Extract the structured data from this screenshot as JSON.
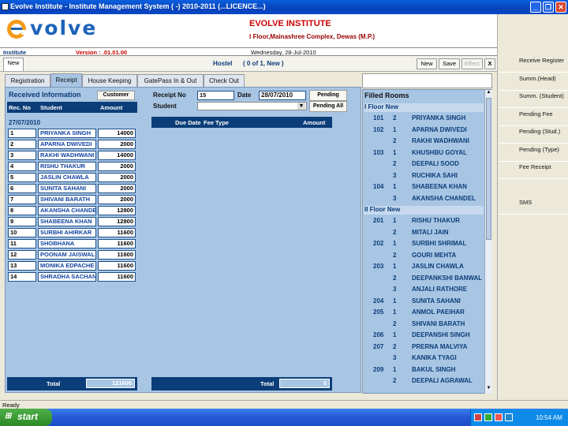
{
  "window": {
    "title": "Evolve Institute - Institute Management System ( -) 2010-2011 (...LICENCE...)"
  },
  "header": {
    "logo_text": "volve",
    "institute_name": "EVOLVE INSTITUTE",
    "address": "I Floor,Mainashree Complex, Dewas (M.P.)"
  },
  "infobar": {
    "institute": "Institute",
    "version": "Version : .01.01.00",
    "date": "Wednesday, 28-Jul-2010"
  },
  "hostelbar": {
    "tab_new": "New",
    "title": "Hostel",
    "record": "( 0 of 1, New )",
    "btn_new": "New",
    "btn_save": "Save",
    "btn_effect": "Effect",
    "btn_close": "X"
  },
  "tabs": [
    "Registration",
    "Receipt",
    "House Keeping",
    "GatePass In & Out",
    "Check Out"
  ],
  "left": {
    "title": "Received Information",
    "customer_btn": "Customer",
    "col_rec": "Rec. No",
    "col_student": "Student",
    "col_amount": "Amount",
    "date": "27/07/2010",
    "rows": [
      {
        "no": "1",
        "name": "PRIYANKA SINGH",
        "amt": "14000"
      },
      {
        "no": "2",
        "name": "APARNA DWIVEDI",
        "amt": "2000"
      },
      {
        "no": "3",
        "name": "RAKHI WADHWANI",
        "amt": "14000"
      },
      {
        "no": "4",
        "name": "RISHU THAKUR",
        "amt": "2000"
      },
      {
        "no": "5",
        "name": "JASLIN CHAWLA",
        "amt": "2000"
      },
      {
        "no": "6",
        "name": "SUNITA SAHANI",
        "amt": "2000"
      },
      {
        "no": "7",
        "name": "SHIVANI BARATH",
        "amt": "2000"
      },
      {
        "no": "8",
        "name": "AKANSHA CHANDEL",
        "amt": "12800"
      },
      {
        "no": "9",
        "name": "SHABEENA KHAN",
        "amt": "12800"
      },
      {
        "no": "10",
        "name": "SURBHI AHIRKAR",
        "amt": "11600"
      },
      {
        "no": "11",
        "name": "SHOBHANA",
        "amt": "11600"
      },
      {
        "no": "12",
        "name": "POONAM JAISWAL",
        "amt": "11600"
      },
      {
        "no": "13",
        "name": "MONIKA EDPACHE",
        "amt": "11600"
      },
      {
        "no": "14",
        "name": "SHRADHA SACHAN",
        "amt": "11600"
      }
    ],
    "total_label": "Total",
    "total_value": "121600"
  },
  "mid": {
    "receipt_label": "Receipt No",
    "receipt_value": "15",
    "date_label": "Date",
    "date_value": "28/07/2010",
    "pending_btn": "Pending",
    "student_label": "Student",
    "pending_all_btn": "Pending All",
    "col_due": "Due Date",
    "col_fee": "Fee Type",
    "col_amount": "Amount",
    "total_label": "Total",
    "total_value": "0"
  },
  "rooms": {
    "title": "Filled Rooms",
    "floors": [
      {
        "name": "I Floor New",
        "rows": [
          {
            "room": "101",
            "bed": "2",
            "name": "PRIYANKA SINGH"
          },
          {
            "room": "102",
            "bed": "1",
            "name": "APARNA DWIVEDI"
          },
          {
            "room": "",
            "bed": "2",
            "name": "RAKHI WADHWANI"
          },
          {
            "room": "103",
            "bed": "1",
            "name": "KHUSHBU GOYAL"
          },
          {
            "room": "",
            "bed": "2",
            "name": "DEEPALI SOOD"
          },
          {
            "room": "",
            "bed": "3",
            "name": "RUCHIKA SAHI"
          },
          {
            "room": "104",
            "bed": "1",
            "name": "SHABEENA KHAN"
          },
          {
            "room": "",
            "bed": "3",
            "name": "AKANSHA CHANDEL"
          }
        ]
      },
      {
        "name": "II Floor New",
        "rows": [
          {
            "room": "201",
            "bed": "1",
            "name": "RISHU THAKUR"
          },
          {
            "room": "",
            "bed": "2",
            "name": "MITALI JAIN"
          },
          {
            "room": "202",
            "bed": "1",
            "name": "SURBHI SHRIMAL"
          },
          {
            "room": "",
            "bed": "2",
            "name": "GOURI MEHTA"
          },
          {
            "room": "203",
            "bed": "1",
            "name": "JASLIN CHAWLA"
          },
          {
            "room": "",
            "bed": "2",
            "name": "DEEPANKSHI BANWAL"
          },
          {
            "room": "",
            "bed": "3",
            "name": "ANJALI RATHORE"
          },
          {
            "room": "204",
            "bed": "1",
            "name": "SUNITA SAHANI"
          },
          {
            "room": "205",
            "bed": "1",
            "name": "ANMOL PAEIHAR"
          },
          {
            "room": "",
            "bed": "2",
            "name": "SHIVANI BARATH"
          },
          {
            "room": "206",
            "bed": "1",
            "name": "DEEPANSHI SINGH"
          },
          {
            "room": "207",
            "bed": "2",
            "name": "PRERNA MALVIYA"
          },
          {
            "room": "",
            "bed": "3",
            "name": "KANIKA TYAGI"
          },
          {
            "room": "209",
            "bed": "1",
            "name": "BAKUL SINGH"
          },
          {
            "room": "",
            "bed": "2",
            "name": "DEEPALI AGRAWAL"
          }
        ]
      }
    ]
  },
  "sidebar": [
    "Receive Register",
    "Summ.(Head)",
    "Summ. (Student)",
    "Pending Fee",
    "Pending (Stud.)",
    "Pending (Type)",
    "Fee Receipt",
    "SMS"
  ],
  "status": {
    "text": "Ready"
  },
  "taskbar": {
    "start": "start",
    "clock": "10:54 AM"
  },
  "colors": {
    "accent": "#a8c6e4",
    "header_blue": "#0b3d78",
    "red": "#cc0000"
  }
}
